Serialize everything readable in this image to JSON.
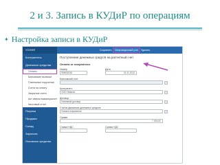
{
  "slide": {
    "title": "2 и 3. Запись в КУДиР по операциям",
    "bullet": "Настройка записи в КУДиР"
  },
  "sidebar": {
    "header": "УСНИФ",
    "items": [
      "Контрагенты",
      "Денежные средства"
    ],
    "subitems": [
      "Оплаты",
      "Банковские выписки",
      "Платежные поручения",
      "Счета на оплату",
      "Закрытые счета",
      "Акт сверки взаиморасчетов",
      "Кассовый отчет"
    ],
    "bottom_items": [
      "Покупки",
      "Продажи",
      "Склад",
      "Зарплата",
      "Основные средства"
    ]
  },
  "toolbar": {
    "buttons": [
      "Сохранить",
      "Непроведенный учет",
      "Удалить"
    ]
  },
  "form": {
    "page_title": "Поступление денежных средств на расчетный счет",
    "section_title": "Оплата от покупателя",
    "fields": [
      {
        "label": "Номер",
        "value": "ПКВ00038"
      },
      {
        "label": "Дата",
        "value": "22.11.2012"
      },
      {
        "label": "Банковский счет",
        "value": ""
      },
      {
        "label": "Контрагент",
        "value": "ООО Иванов"
      },
      {
        "label": "Договор",
        "value": "Основной договор"
      },
      {
        "label": "Статья движения денежных средств",
        "value": "Оплата покупателя"
      },
      {
        "label": "Сумма",
        "value": "7 000,00"
      },
      {
        "label": "Ставка НДС",
        "value": ""
      },
      {
        "label": "Сумма НДС",
        "value": ""
      }
    ]
  },
  "colors": {
    "title": "#1f8a8a",
    "sidebar": "#1f5a94",
    "highlight": "#b04bb5"
  }
}
